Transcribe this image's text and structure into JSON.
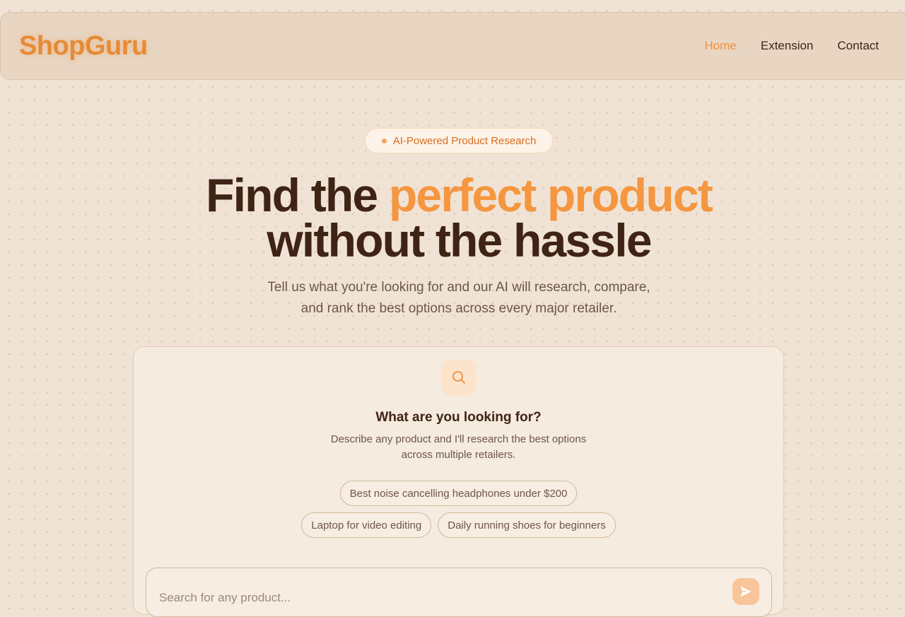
{
  "brand": {
    "name": "ShopGuru"
  },
  "nav": {
    "links": [
      {
        "label": "Home",
        "active": true
      },
      {
        "label": "Extension",
        "active": false
      },
      {
        "label": "Contact",
        "active": false
      }
    ]
  },
  "hero": {
    "badge": "AI-Powered Product Research",
    "headline_part1": "Find the ",
    "headline_accent": "perfect product",
    "headline_line2": "without the hassle",
    "subtitle_line1": "Tell us what you're looking for and our AI will research, compare,",
    "subtitle_line2": "and rank the best options across every major retailer."
  },
  "search_card": {
    "icon": "search-icon",
    "title": "What are you looking for?",
    "desc_line1": "Describe any product and I'll research the best options",
    "desc_line2": "across multiple retailers.",
    "suggestions": [
      "Best noise cancelling headphones under $200",
      "Laptop for video editing",
      "Daily running shoes for beginners"
    ],
    "input_placeholder": "Search for any product...",
    "input_value": "",
    "send_icon": "send-icon"
  },
  "colors": {
    "accent": "#f59640",
    "brand": "#e88a35",
    "text_dark": "#3f2415",
    "background": "#f0e3d5"
  }
}
